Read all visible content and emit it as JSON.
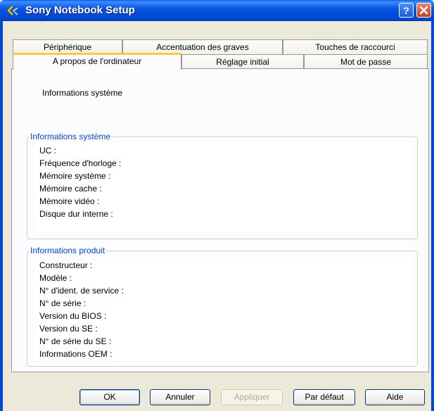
{
  "window": {
    "title": "Sony Notebook Setup",
    "icons": [
      "app-icon",
      "help-icon",
      "close-icon"
    ]
  },
  "tabs": {
    "row_back": [
      "Périphérique",
      "Accentuation des graves",
      "Touches de raccourci"
    ],
    "row_front": [
      "A propos de l'ordinateur",
      "Réglage initial",
      "Mot de passe"
    ],
    "active": "A propos de l'ordinateur"
  },
  "main": {
    "heading": "Informations système",
    "system_group": {
      "title": "Informations système",
      "fields": [
        "UC :",
        "Fréquence d'horloge :",
        "Mémoire système :",
        "Mémoire cache :",
        "Mémoire vidéo :",
        "Disque dur interne :"
      ]
    },
    "product_group": {
      "title": "Informations produit",
      "fields": [
        "Constructeur :",
        "Modèle :",
        "N° d'ident. de service :",
        "N° de série :",
        "Version du BIOS :",
        "Version du SE :",
        "N° de série du SE :",
        "Informations OEM :"
      ]
    }
  },
  "buttons": {
    "ok": "OK",
    "cancel": "Annuler",
    "apply": "Appliquer",
    "default": "Par défaut",
    "help": "Aide"
  },
  "colors": {
    "titlebar": "#0047d6",
    "window_bg": "#ece9d8",
    "panel_bg": "#fcfcfe",
    "group_label": "#0046d5",
    "active_tab_accent": "#ffc83c",
    "close_button": "#c6401e"
  }
}
